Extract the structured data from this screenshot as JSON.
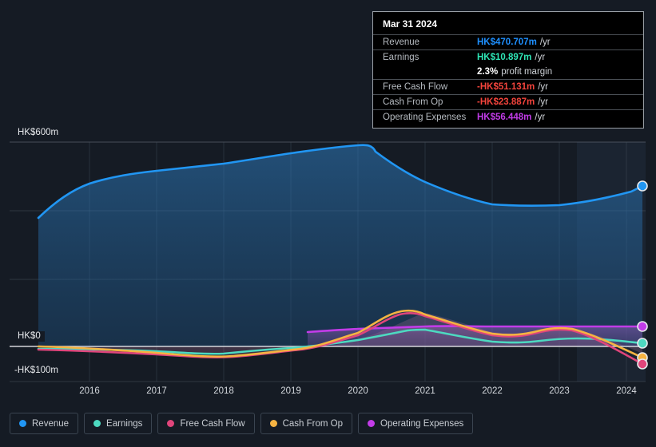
{
  "background_color": "#151b24",
  "tooltip": {
    "date": "Mar 31 2024",
    "rows": [
      {
        "key": "Revenue",
        "value": "HK$470.707m",
        "unit": "/yr",
        "color": "#1e90ff"
      },
      {
        "key": "Earnings",
        "value": "HK$10.897m",
        "unit": "/yr",
        "color": "#2ee6b6"
      },
      {
        "key": "",
        "value": "2.3%",
        "unit": "profit margin",
        "color": "#ffffff"
      },
      {
        "key": "Free Cash Flow",
        "value": "-HK$51.131m",
        "unit": "/yr",
        "color": "#f4443c"
      },
      {
        "key": "Cash From Op",
        "value": "-HK$23.887m",
        "unit": "/yr",
        "color": "#f4443c"
      },
      {
        "key": "Operating Expenses",
        "value": "HK$56.448m",
        "unit": "/yr",
        "color": "#c23ce8"
      }
    ]
  },
  "legend": [
    {
      "label": "Revenue",
      "color": "#2196f3"
    },
    {
      "label": "Earnings",
      "color": "#4dd9c0"
    },
    {
      "label": "Free Cash Flow",
      "color": "#e0457b"
    },
    {
      "label": "Cash From Op",
      "color": "#f5b342"
    },
    {
      "label": "Operating Expenses",
      "color": "#c23ce8"
    }
  ],
  "axis": {
    "y_ticks": [
      {
        "label": "HK$600m",
        "value": 600
      },
      {
        "label": "HK$0",
        "value": 0
      },
      {
        "label": "-HK$100m",
        "value": -100
      }
    ],
    "x_ticks": [
      "2016",
      "2017",
      "2018",
      "2019",
      "2020",
      "2021",
      "2022",
      "2023",
      "2024"
    ]
  },
  "chart_data": {
    "type": "area",
    "title": "",
    "xlabel": "",
    "ylabel": "HK$",
    "ylim": [
      -100,
      600
    ],
    "xlim": [
      2015.2,
      2024.4
    ],
    "grid": true,
    "legend_position": "bottom",
    "y_tick_values": [
      600,
      400,
      200,
      0,
      -100
    ],
    "x": [
      2015.2,
      2015.6,
      2016.0,
      2016.5,
      2017.0,
      2017.5,
      2018.0,
      2018.5,
      2019.0,
      2019.5,
      2020.0,
      2020.5,
      2021.0,
      2021.5,
      2022.0,
      2022.5,
      2023.0,
      2023.5,
      2024.25
    ],
    "series": [
      {
        "name": "Revenue",
        "color": "#2196f3",
        "values": [
          378,
          420,
          462,
          483,
          492,
          500,
          510,
          525,
          540,
          560,
          578,
          560,
          535,
          510,
          478,
          472,
          468,
          466,
          470.707
        ]
      },
      {
        "name": "Earnings",
        "color": "#4dd9c0",
        "values": [
          -8,
          -7,
          -6,
          -7,
          -9,
          -10,
          -13,
          -16,
          -18,
          -20,
          -20,
          -10,
          14,
          10,
          5,
          1,
          3,
          8,
          10.897
        ]
      },
      {
        "name": "Free Cash Flow",
        "color": "#e0457b",
        "values": [
          -10,
          -9,
          -9,
          -11,
          -14,
          -17,
          -22,
          -28,
          -25,
          -22,
          -20,
          22,
          58,
          32,
          12,
          18,
          26,
          4,
          -51.131
        ]
      },
      {
        "name": "Cash From Op",
        "color": "#f5b342",
        "values": [
          -3,
          -2,
          -2,
          -4,
          -8,
          -12,
          -18,
          -24,
          -20,
          -16,
          -14,
          30,
          68,
          42,
          20,
          24,
          32,
          12,
          -23.887
        ]
      },
      {
        "name": "Operating Expenses",
        "color": "#c23ce8",
        "start_x": 2019.0,
        "values": [
          null,
          null,
          null,
          null,
          null,
          null,
          null,
          null,
          42,
          45,
          48,
          50,
          52,
          54,
          53,
          54,
          55,
          56,
          56.448
        ]
      }
    ],
    "annotations": [
      {
        "type": "forecast-band",
        "from_x": 2023.1,
        "to_x": 2024.4
      },
      {
        "type": "zero-line",
        "value": 0
      }
    ]
  }
}
